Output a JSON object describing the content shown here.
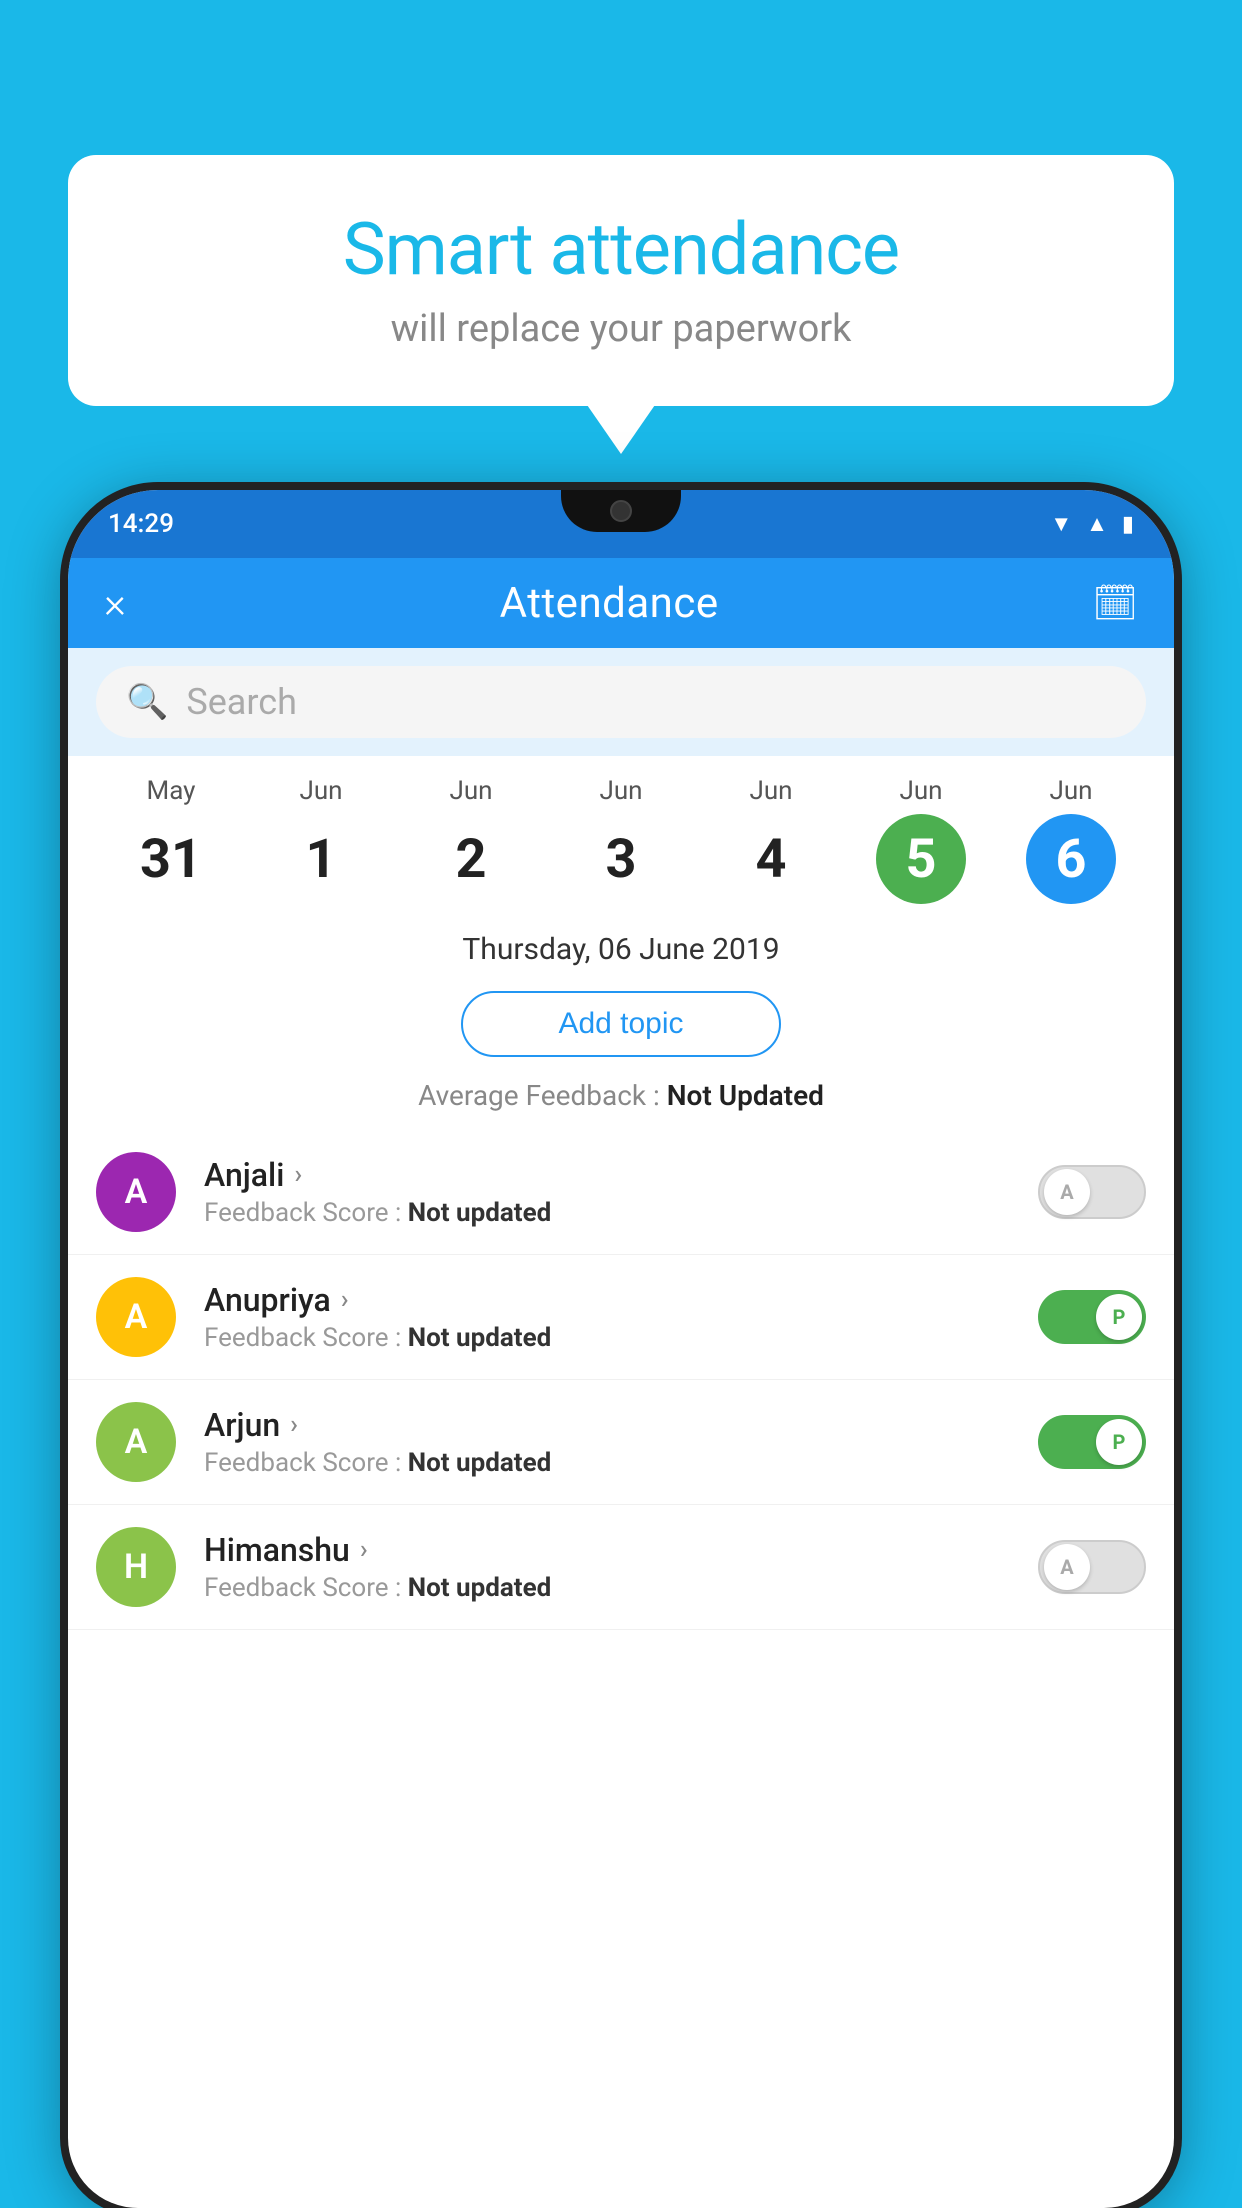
{
  "background_color": "#1ab8e8",
  "bubble": {
    "title": "Smart attendance",
    "subtitle": "will replace your paperwork"
  },
  "app": {
    "status_time": "14:29",
    "app_title": "Attendance",
    "close_label": "×",
    "calendar_icon": "📅",
    "search_placeholder": "Search",
    "date_label": "Thursday, 06 June 2019",
    "add_topic_label": "Add topic",
    "avg_feedback_label": "Average Feedback : ",
    "avg_feedback_value": "Not Updated"
  },
  "calendar": {
    "days": [
      {
        "month": "May",
        "date": "31",
        "state": "normal"
      },
      {
        "month": "Jun",
        "date": "1",
        "state": "normal"
      },
      {
        "month": "Jun",
        "date": "2",
        "state": "normal"
      },
      {
        "month": "Jun",
        "date": "3",
        "state": "normal"
      },
      {
        "month": "Jun",
        "date": "4",
        "state": "normal"
      },
      {
        "month": "Jun",
        "date": "5",
        "state": "today"
      },
      {
        "month": "Jun",
        "date": "6",
        "state": "selected"
      }
    ]
  },
  "students": [
    {
      "name": "Anjali",
      "initial": "A",
      "avatar_color": "#9c27b0",
      "feedback": "Not updated",
      "toggle": "off"
    },
    {
      "name": "Anupriya",
      "initial": "A",
      "avatar_color": "#ffc107",
      "feedback": "Not updated",
      "toggle": "on"
    },
    {
      "name": "Arjun",
      "initial": "A",
      "avatar_color": "#8bc34a",
      "feedback": "Not updated",
      "toggle": "on"
    },
    {
      "name": "Himanshu",
      "initial": "H",
      "avatar_color": "#8bc34a",
      "feedback": "Not updated",
      "toggle": "off"
    }
  ]
}
